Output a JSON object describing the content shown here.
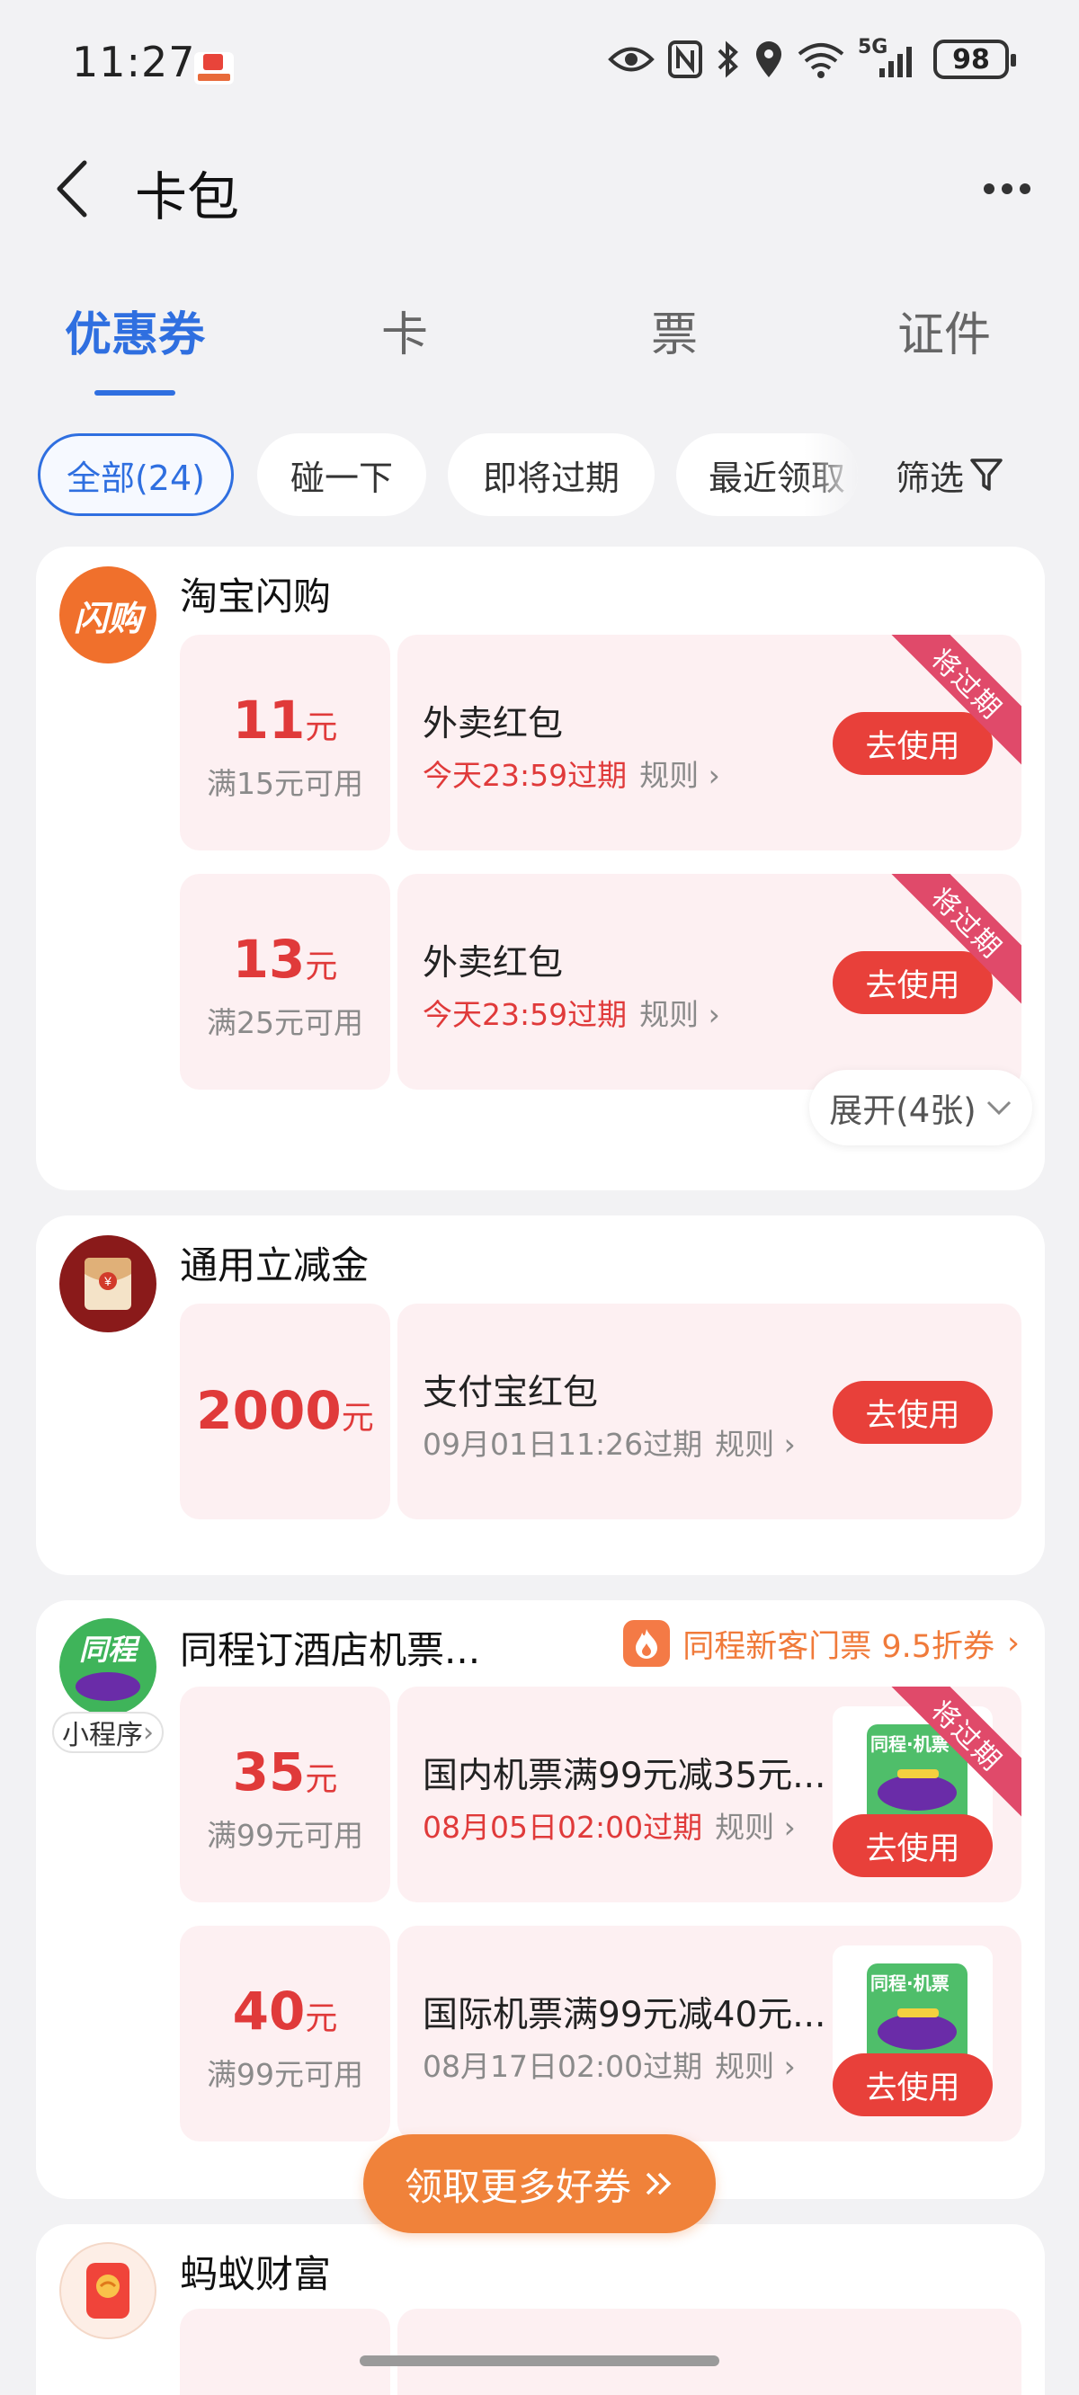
{
  "status_bar": {
    "time": "11:27",
    "signal_label": "5G",
    "battery": "98"
  },
  "header": {
    "title": "卡包"
  },
  "tabs": [
    {
      "label": "优惠券",
      "active": true
    },
    {
      "label": "卡",
      "active": false
    },
    {
      "label": "票",
      "active": false
    },
    {
      "label": "证件",
      "active": false
    }
  ],
  "filters": {
    "chips": [
      "全部(24)",
      "碰一下",
      "即将过期",
      "最近领取"
    ],
    "filter_label": "筛选"
  },
  "groups": [
    {
      "title": "淘宝闪购",
      "logo_text": "闪购",
      "coupons": [
        {
          "amount": "11",
          "unit": "元",
          "condition": "满15元可用",
          "name": "外卖红包",
          "expire": "今天23:59过期",
          "rule": "规则",
          "button": "去使用",
          "ribbon": "将过期"
        },
        {
          "amount": "13",
          "unit": "元",
          "condition": "满25元可用",
          "name": "外卖红包",
          "expire": "今天23:59过期",
          "rule": "规则",
          "button": "去使用",
          "ribbon": "将过期"
        }
      ],
      "expand_label": "展开(4张)"
    },
    {
      "title": "通用立减金",
      "coupons": [
        {
          "amount": "2000",
          "unit": "元",
          "name": "支付宝红包",
          "expire": "09月01日11:26过期",
          "rule": "规则",
          "button": "去使用"
        }
      ]
    },
    {
      "title": "同程订酒店机票...",
      "logo_text": "同程",
      "mini_badge": "小程序",
      "promo": "同程新客门票 9.5折券",
      "coupons": [
        {
          "amount": "35",
          "unit": "元",
          "condition": "满99元可用",
          "name": "国内机票满99元减35元...",
          "expire": "08月05日02:00过期",
          "rule": "规则",
          "button": "去使用",
          "ribbon": "将过期",
          "thumb_text": "同程·机票"
        },
        {
          "amount": "40",
          "unit": "元",
          "condition": "满99元可用",
          "name": "国际机票满99元减40元...",
          "expire": "08月17日02:00过期",
          "rule": "规则",
          "button": "去使用",
          "thumb_text": "同程·机票"
        }
      ]
    },
    {
      "title": "蚂蚁财富"
    }
  ],
  "more_coupons_label": "领取更多好券",
  "colors": {
    "accent_blue": "#2f6fe0",
    "coupon_red": "#e03a3a",
    "button_red": "#e8403a",
    "ribbon_pink": "#e04a6a",
    "promo_orange": "#f0823a"
  }
}
